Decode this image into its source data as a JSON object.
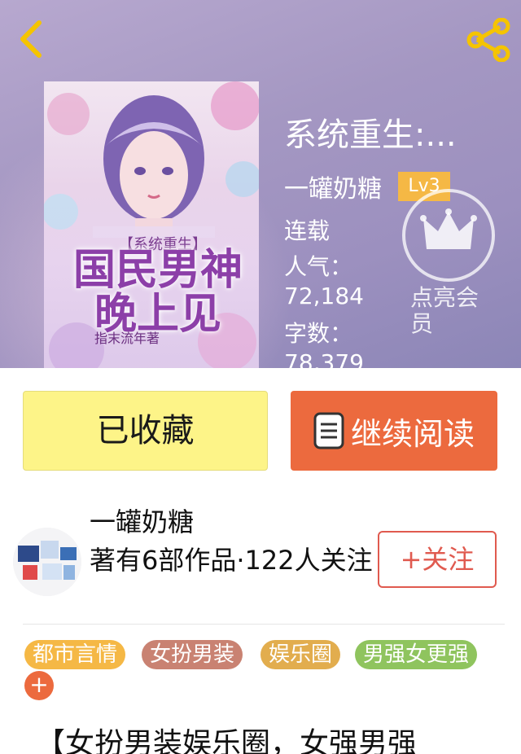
{
  "header": {
    "back_icon": "chevron-left-icon",
    "share_icon": "share-icon",
    "icon_color": "#f5c400"
  },
  "book": {
    "cover": {
      "series_tag": "【系统重生】",
      "title_line1": "国民男神",
      "title_line2": "晚上见",
      "author_credit": "指末流年",
      "author_credit_suffix": "著"
    },
    "title": "系统重生:...",
    "author": "一罐奶糖",
    "level": "Lv3",
    "status": "连载",
    "popularity_label": "人气：",
    "popularity_value": "72,184",
    "word_count_label": "字数：",
    "word_count_value": "78,379"
  },
  "vip": {
    "icon": "crown-icon",
    "label": "点亮会员"
  },
  "actions": {
    "collected_label": "已收藏",
    "read_label": "继续阅读",
    "read_icon": "book-icon"
  },
  "author_block": {
    "name": "一罐奶糖",
    "stats": "著有6部作品·122人关注",
    "follow_label": "+关注"
  },
  "tags": [
    {
      "label": "都市言情",
      "color": "#f5b845"
    },
    {
      "label": "女扮男装",
      "color": "#c98272"
    },
    {
      "label": "娱乐圈",
      "color": "#e2ad4e"
    },
    {
      "label": "男强女更强",
      "color": "#8fc45e"
    }
  ],
  "tag_add_label": "+",
  "intro": {
    "text": "【女扮男装娱乐圈，女强男强"
  },
  "colors": {
    "accent_orange": "#ec6a3e",
    "collected_yellow": "#fdf488",
    "level_badge": "#f5b845",
    "follow_red": "#e05a4f"
  }
}
